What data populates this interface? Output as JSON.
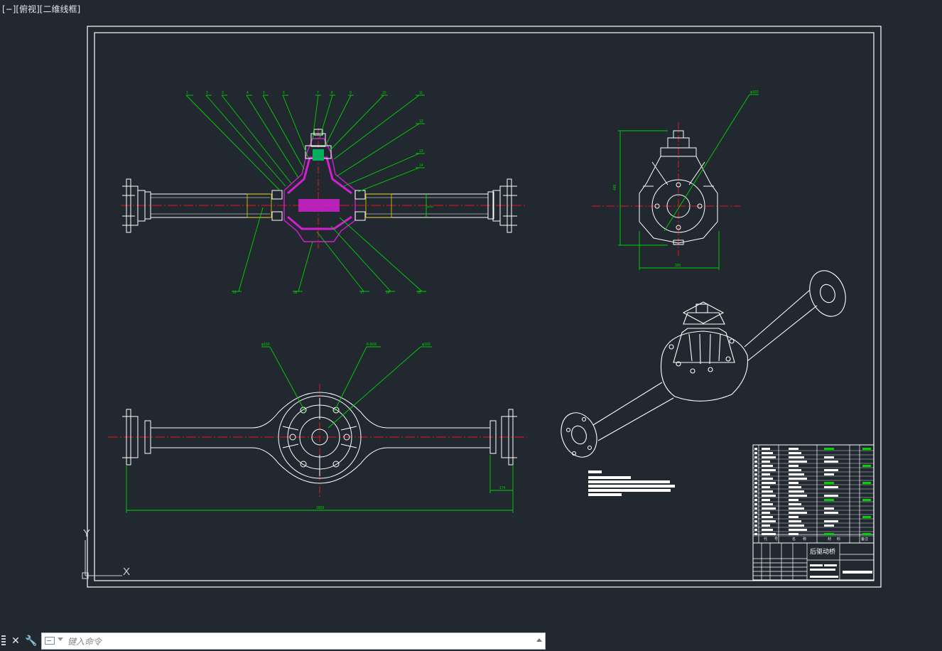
{
  "viewport": {
    "label": "[−][俯视][二维线框]"
  },
  "drawing": {
    "title": "后驱动桥",
    "dim_overall": "1839",
    "dim_offset": "174",
    "dim_height": "445",
    "dim_width": "320",
    "dim_tube": "φ100",
    "callout_side": "φ160",
    "callout_bottom": [
      "φ150",
      "8-M16",
      "φ160"
    ],
    "part_numbers_top": [
      "1",
      "2",
      "3",
      "4",
      "5",
      "6",
      "7",
      "8",
      "9",
      "10",
      "11",
      "12",
      "13",
      "14"
    ],
    "part_numbers_bottom": [
      "19",
      "18",
      "17",
      "16",
      "15"
    ],
    "table_headers": [
      "代",
      "号",
      "名",
      "称",
      "材",
      "料",
      "备注"
    ]
  },
  "colors": {
    "background": "#212830",
    "line": "#ffffff",
    "leader": "#00d400",
    "center": "#e01818",
    "section": "#d020d0"
  },
  "ucs": {
    "y_label": "Y",
    "x_label": "X"
  },
  "command": {
    "placeholder": "键入命令",
    "close_icon": "close-icon",
    "settings_icon": "wrench-icon"
  }
}
